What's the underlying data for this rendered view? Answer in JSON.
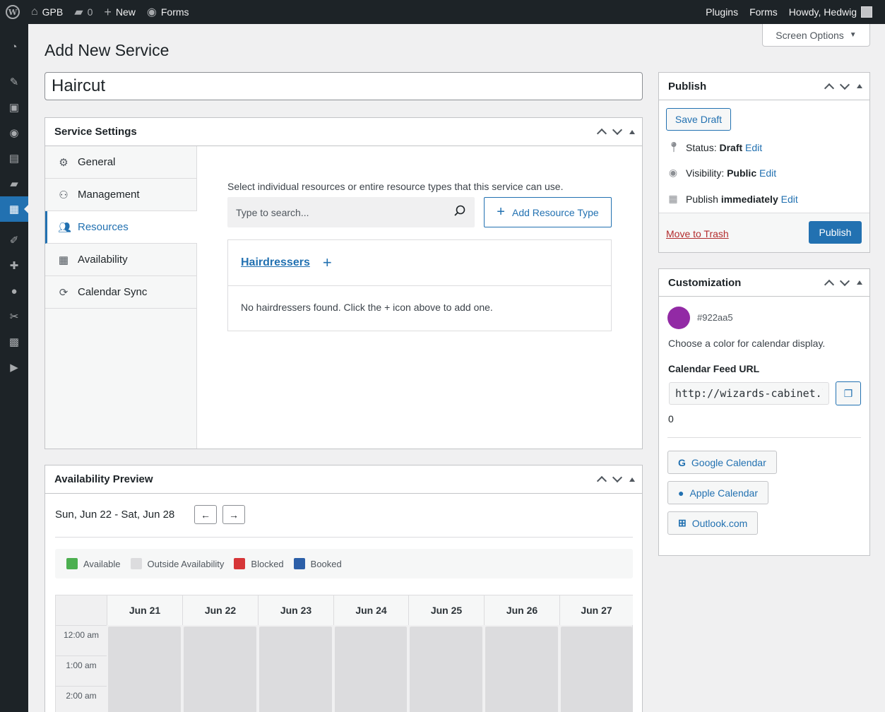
{
  "adminbar": {
    "site_name": "GPB",
    "comments_count": "0",
    "new_label": "New",
    "forms_label": "Forms",
    "plugins_label": "Plugins",
    "forms_right_label": "Forms",
    "howdy": "Howdy, Hedwig"
  },
  "menu_icons": [
    "dashboard-icon",
    "pin-icon",
    "media-icon",
    "forms-icon",
    "pages-icon",
    "comments-icon",
    "calendar-icon",
    "appearance-icon",
    "plugins-icon",
    "users-icon",
    "tools-icon",
    "settings-icon",
    "play-icon"
  ],
  "screen_options": "Screen Options",
  "page_title": "Add New Service",
  "title_value": "Haircut",
  "service_settings": {
    "title": "Service Settings",
    "tabs": [
      {
        "label": "General",
        "icon": "gear-icon"
      },
      {
        "label": "Management",
        "icon": "user-gear-icon"
      },
      {
        "label": "Resources",
        "icon": "users-icon",
        "active": true
      },
      {
        "label": "Availability",
        "icon": "calendar-icon"
      },
      {
        "label": "Calendar Sync",
        "icon": "sync-icon"
      }
    ],
    "resources": {
      "description": "Select individual resources or entire resource types that this service can use.",
      "search_placeholder": "Type to search...",
      "add_type_label": "Add Resource Type",
      "card_title": "Hairdressers",
      "empty_text": "No hairdressers found. Click the + icon above to add one."
    }
  },
  "availability": {
    "title": "Availability Preview",
    "week_range": "Sun, Jun 22 - Sat, Jun 28",
    "legend": [
      {
        "label": "Available",
        "color": "#4caf50"
      },
      {
        "label": "Outside Availability",
        "color": "#dcdcde"
      },
      {
        "label": "Blocked",
        "color": "#d63638"
      },
      {
        "label": "Booked",
        "color": "#2c5fa8"
      }
    ],
    "days": [
      "Jun 21",
      "Jun 22",
      "Jun 23",
      "Jun 24",
      "Jun 25",
      "Jun 26",
      "Jun 27"
    ],
    "hours": [
      "12:00 am",
      "1:00 am",
      "2:00 am"
    ]
  },
  "publish": {
    "title": "Publish",
    "save_draft": "Save Draft",
    "status_label": "Status:",
    "status_value": "Draft",
    "visibility_label": "Visibility:",
    "visibility_value": "Public",
    "publish_label": "Publish",
    "publish_value": "immediately",
    "edit": "Edit",
    "move_to_trash": "Move to Trash",
    "publish_button": "Publish"
  },
  "customization": {
    "title": "Customization",
    "color": "#922aa5",
    "color_hex": "#922aa5",
    "color_desc": "Choose a color for calendar display.",
    "feed_label": "Calendar Feed URL",
    "feed_url": "http://wizards-cabinet.local",
    "feed_count": "0",
    "google": "Google Calendar",
    "apple": "Apple Calendar",
    "outlook": "Outlook.com"
  }
}
